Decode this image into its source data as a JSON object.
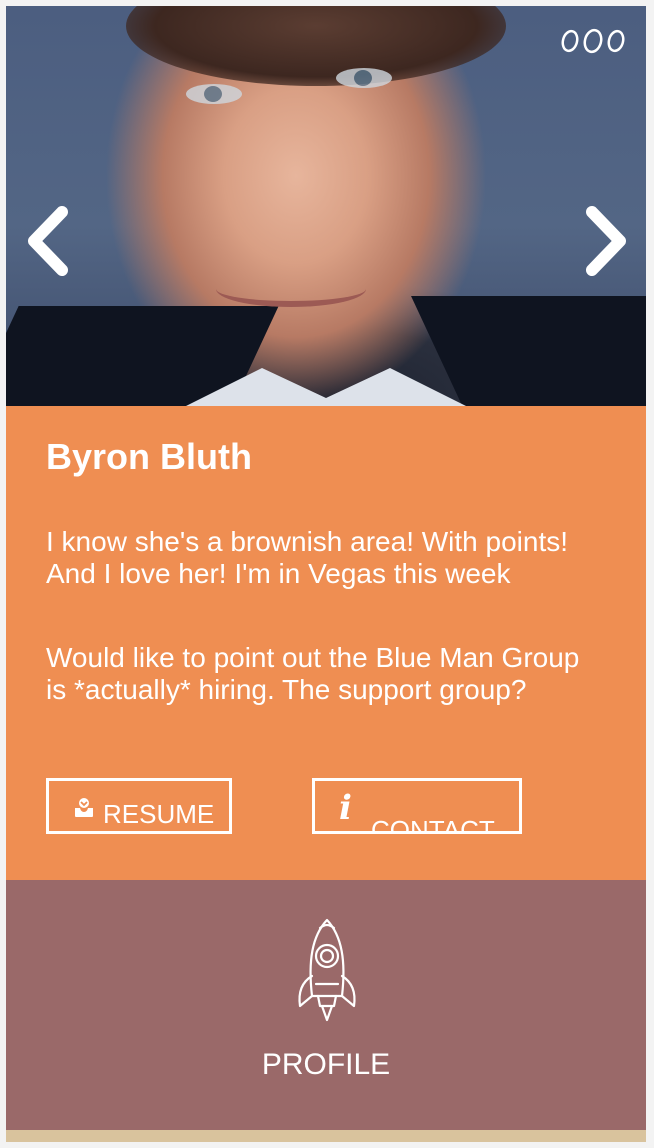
{
  "profile": {
    "name": "Byron Bluth",
    "bio": [
      "I know she's a brownish area! With points! And I love her! I'm in Vegas this week",
      "Would like to point out the Blue Man Group is *actually* hiring. The support group?"
    ]
  },
  "buttons": {
    "resume_label": "RESUME",
    "contact_label": "CONTACT",
    "resume_icon": "download-tray-icon",
    "contact_icon": "info-icon"
  },
  "footer": {
    "label": "PROFILE",
    "icon": "rocket-icon"
  },
  "hero": {
    "prev_icon": "chevron-left-icon",
    "next_icon": "chevron-right-icon",
    "menu_icon": "three-dots-icon"
  },
  "colors": {
    "info_panel": "#ef8e52",
    "profile_panel": "#9a6969",
    "bottom_strip": "#d9c39d",
    "text": "#ffffff"
  }
}
